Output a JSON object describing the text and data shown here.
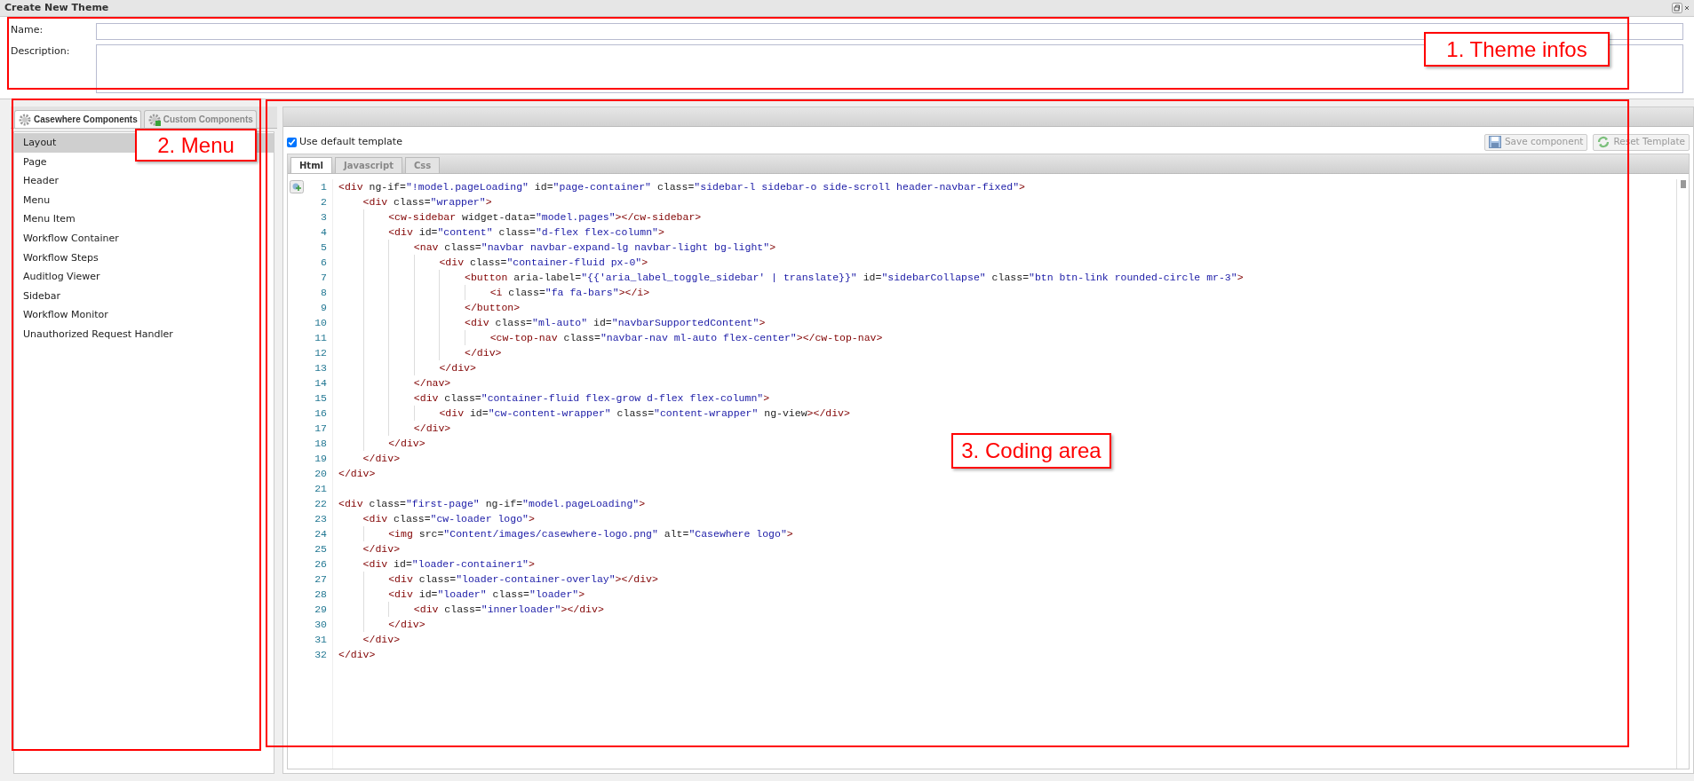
{
  "window": {
    "title": "Create New Theme"
  },
  "theme_info": {
    "name_label": "Name:",
    "description_label": "Description:"
  },
  "component_tabs": [
    {
      "label": "Casewhere Components",
      "selected": true
    },
    {
      "label": "Custom Components",
      "selected": false
    }
  ],
  "menu": [
    {
      "label": "Layout",
      "selected": true
    },
    {
      "label": "Page",
      "selected": false
    },
    {
      "label": "Header",
      "selected": false
    },
    {
      "label": "Menu",
      "selected": false
    },
    {
      "label": "Menu Item",
      "selected": false
    },
    {
      "label": "Workflow Container",
      "selected": false
    },
    {
      "label": "Workflow Steps",
      "selected": false
    },
    {
      "label": "Auditlog Viewer",
      "selected": false
    },
    {
      "label": "Sidebar",
      "selected": false
    },
    {
      "label": "Workflow Monitor",
      "selected": false
    },
    {
      "label": "Unauthorized Request Handler",
      "selected": false
    }
  ],
  "editor": {
    "use_default_template": {
      "label": "Use default template",
      "checked": true
    },
    "buttons": [
      {
        "label": "Save component",
        "disabled": true
      },
      {
        "label": "Reset Template",
        "disabled": true
      }
    ],
    "tabs": [
      {
        "label": "Html",
        "selected": true
      },
      {
        "label": "Javascript",
        "selected": false
      },
      {
        "label": "Css",
        "selected": false
      }
    ],
    "lines": [
      {
        "number": "1",
        "text": "<div ng-if=\"!model.pageLoading\" id=\"page-container\" class=\"sidebar-l sidebar-o side-scroll header-navbar-fixed\">"
      },
      {
        "number": "2",
        "text": "    <div class=\"wrapper\">"
      },
      {
        "number": "3",
        "text": "        <cw-sidebar widget-data=\"model.pages\"></cw-sidebar>"
      },
      {
        "number": "4",
        "text": "        <div id=\"content\" class=\"d-flex flex-column\">"
      },
      {
        "number": "5",
        "text": "            <nav class=\"navbar navbar-expand-lg navbar-light bg-light\">"
      },
      {
        "number": "6",
        "text": "                <div class=\"container-fluid px-0\">"
      },
      {
        "number": "7",
        "text": "                    <button aria-label=\"{{'aria_label_toggle_sidebar' | translate}}\" id=\"sidebarCollapse\" class=\"btn btn-link rounded-circle mr-3\">"
      },
      {
        "number": "8",
        "text": "                        <i class=\"fa fa-bars\"></i>"
      },
      {
        "number": "9",
        "text": "                    </button>"
      },
      {
        "number": "10",
        "text": "                    <div class=\"ml-auto\" id=\"navbarSupportedContent\">"
      },
      {
        "number": "11",
        "text": "                        <cw-top-nav class=\"navbar-nav ml-auto flex-center\"></cw-top-nav>"
      },
      {
        "number": "12",
        "text": "                    </div>"
      },
      {
        "number": "13",
        "text": "                </div>"
      },
      {
        "number": "14",
        "text": "            </nav>"
      },
      {
        "number": "15",
        "text": "            <div class=\"container-fluid flex-grow d-flex flex-column\">"
      },
      {
        "number": "16",
        "text": "                <div id=\"cw-content-wrapper\" class=\"content-wrapper\" ng-view></div>"
      },
      {
        "number": "17",
        "text": "            </div>"
      },
      {
        "number": "18",
        "text": "        </div>"
      },
      {
        "number": "19",
        "text": "    </div>"
      },
      {
        "number": "20",
        "text": "</div>"
      },
      {
        "number": "21"
      },
      {
        "number": "22",
        "text": "<div class=\"first-page\" ng-if=\"model.pageLoading\">"
      },
      {
        "number": "23",
        "text": "    <div class=\"cw-loader logo\">"
      },
      {
        "number": "24",
        "text": "        <img src=\"Content/images/casewhere-logo.png\" alt=\"Casewhere logo\">"
      },
      {
        "number": "25",
        "text": "    </div>"
      },
      {
        "number": "26",
        "text": "    <div id=\"loader-container1\">"
      },
      {
        "number": "27",
        "text": "        <div class=\"loader-container-overlay\"></div>"
      },
      {
        "number": "28",
        "text": "        <div id=\"loader\" class=\"loader\">"
      },
      {
        "number": "29",
        "text": "            <div class=\"innerloader\"></div>"
      },
      {
        "number": "30",
        "text": "        </div>"
      },
      {
        "number": "31",
        "text": "    </div>"
      },
      {
        "number": "32",
        "text": "</div>"
      }
    ]
  },
  "annotations": [
    {
      "label": "1. Theme infos"
    },
    {
      "label": "2. Menu"
    },
    {
      "label": "3. Coding area"
    }
  ]
}
